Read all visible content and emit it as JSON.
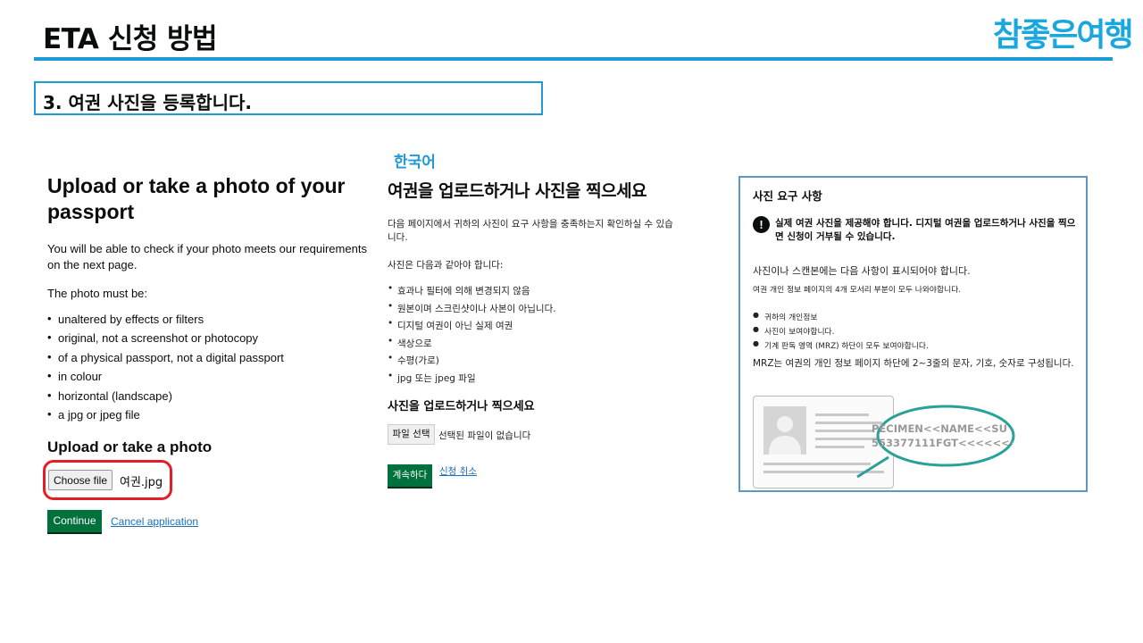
{
  "slide": {
    "title": "ETA 신청 방법",
    "logo_text": "참좋은여행",
    "step": "3. 여권 사진을 등록합니다."
  },
  "english": {
    "title": "Upload or take a photo of your passport",
    "intro": "You will be able to check if your photo meets our requirements on the next page.",
    "must_be": "The photo must be:",
    "requirements": [
      "unaltered by effects or filters",
      "original, not a screenshot or photocopy",
      "of a physical passport, not a digital passport",
      "in colour",
      "horizontal (landscape)",
      "a jpg or jpeg file"
    ],
    "upload_heading": "Upload or take a photo",
    "choose_file_label": "Choose file",
    "file_name": "여권.jpg",
    "continue_label": "Continue",
    "cancel_label": "Cancel application"
  },
  "korean": {
    "language_label": "한국어",
    "title": "여권을 업로드하거나 사진을 찍으세요",
    "intro": "다음 페이지에서 귀하의 사진이 요구 사항을 충족하는지 확인하실 수 있습니다.",
    "must_be": "사진은 다음과 같아야 합니다:",
    "requirements": [
      "효과나 필터에 의해 변경되지 않음",
      "원본이며 스크린샷이나 사본이 아닙니다.",
      "디지털 여권이 아닌 실제 여권",
      "색상으로",
      "수평(가로)",
      "jpg 또는 jpeg 파일"
    ],
    "upload_heading": "사진을 업로드하거나 찍으세요",
    "file_button_label": "파일 선택",
    "no_file_text": "선택된 파일이 없습니다",
    "continue_label": "계속하다",
    "cancel_label": "신청 취소"
  },
  "requirements_panel": {
    "title": "사진 요구 사항",
    "warning_icon": "!",
    "warning": "실제 여권 사진을 제공해야 합니다. 디지털 여권을 업로드하거나 사진을 찍으면 신청이 거부될 수 있습니다.",
    "intro": "사진이나 스캔본에는 다음 사항이 표시되어야 합니다.",
    "corners_note": "여권 개인 정보 페이지의 4개 모서리 부분이 모두 나와야합니다.",
    "items": [
      "귀하의 개인정보",
      "사진이 보여야합니다.",
      "기계 판독 영역 (MRZ) 하단이 모두 보여야합니다."
    ],
    "mrz_note": "MRZ는 여권의 개인 정보 페이지 하단에 2~3줄의 문자, 기호, 숫자로 구성됩니다.",
    "mrz_line1": "PECIMEN<<NAME<<SU",
    "mrz_line2": "553377111FGT<<<<<<<<"
  },
  "colors": {
    "accent": "#1e9ad6",
    "gov_green": "#00703c",
    "link_blue": "#1d70b8",
    "highlight_red": "#e41e26",
    "zoom_teal": "#2aa198"
  }
}
